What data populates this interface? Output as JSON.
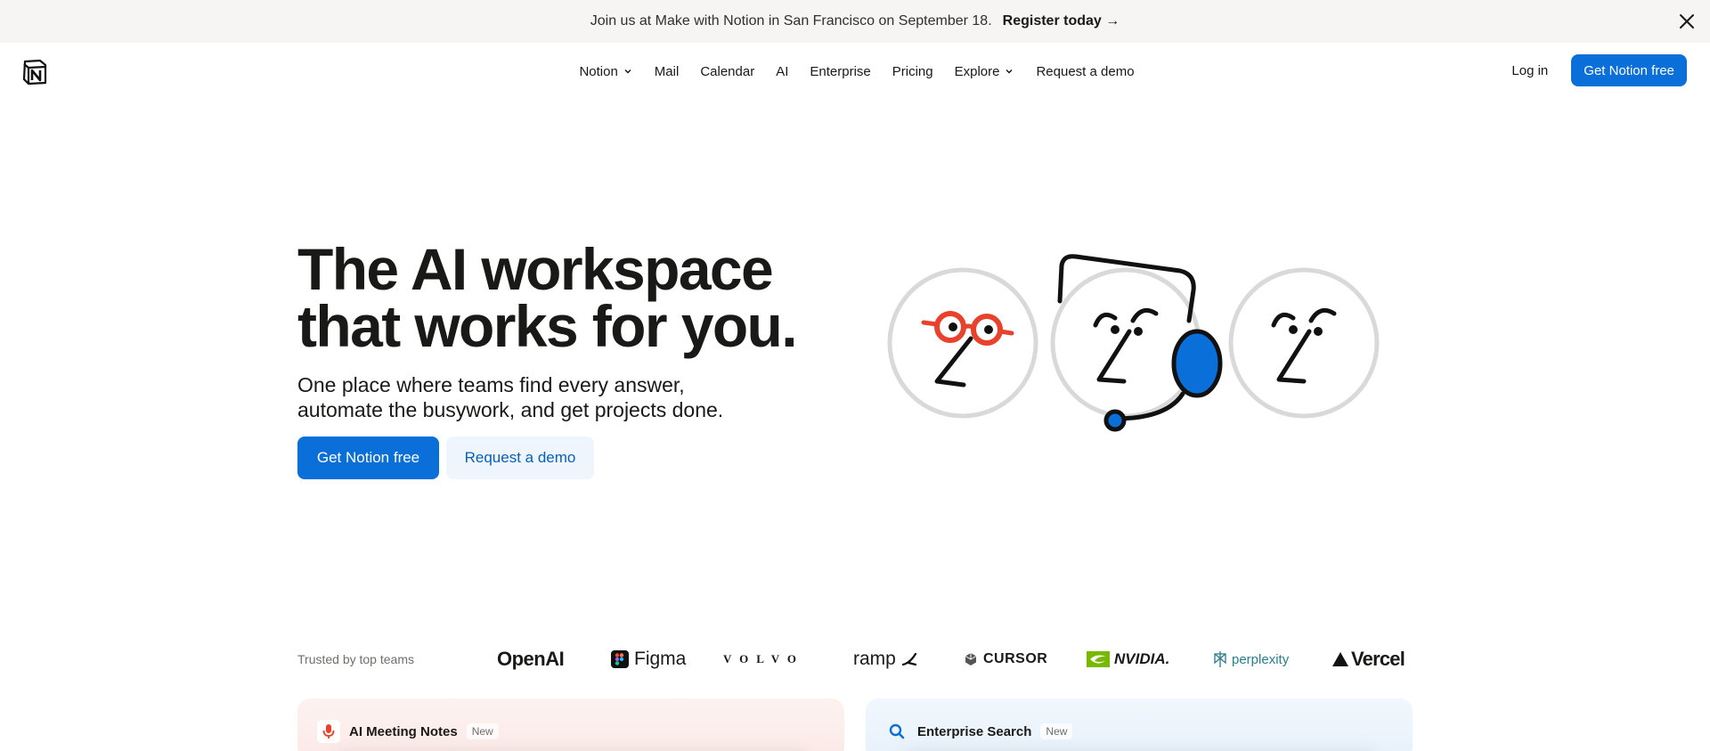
{
  "banner": {
    "text": "Join us at Make with Notion in San Francisco on September 18.",
    "link_label": "Register today →",
    "close_icon": "close-icon"
  },
  "nav": {
    "logo_icon": "notion-logo",
    "items": [
      {
        "label": "Notion",
        "has_dropdown": true
      },
      {
        "label": "Mail",
        "has_dropdown": false
      },
      {
        "label": "Calendar",
        "has_dropdown": false
      },
      {
        "label": "AI",
        "has_dropdown": false
      },
      {
        "label": "Enterprise",
        "has_dropdown": false
      },
      {
        "label": "Pricing",
        "has_dropdown": false
      },
      {
        "label": "Explore",
        "has_dropdown": true
      },
      {
        "label": "Request a demo",
        "has_dropdown": false
      }
    ],
    "login_label": "Log in",
    "cta_label": "Get Notion free"
  },
  "hero": {
    "title_line1": "The AI workspace",
    "title_line2": "that works for you.",
    "subtitle_line1": "One place where teams find every answer,",
    "subtitle_line2": "automate the busywork, and get projects done.",
    "primary_button": "Get Notion free",
    "secondary_button": "Request a demo"
  },
  "trusted": {
    "label": "Trusted by top teams",
    "brands": [
      "OpenAI",
      "Figma",
      "VOLVO",
      "ramp",
      "CURSOR",
      "NVIDIA.",
      "perplexity",
      "Vercel"
    ]
  },
  "cards": [
    {
      "title": "AI Meeting Notes",
      "badge": "New",
      "icon": "microphone-icon"
    },
    {
      "title": "Enterprise Search",
      "badge": "New",
      "icon": "search-icon"
    }
  ],
  "colors": {
    "accent": "#0a6fd9",
    "banner_bg": "#f6f5f4",
    "illustration_red": "#e8412c",
    "illustration_blue": "#0a6fd9"
  }
}
